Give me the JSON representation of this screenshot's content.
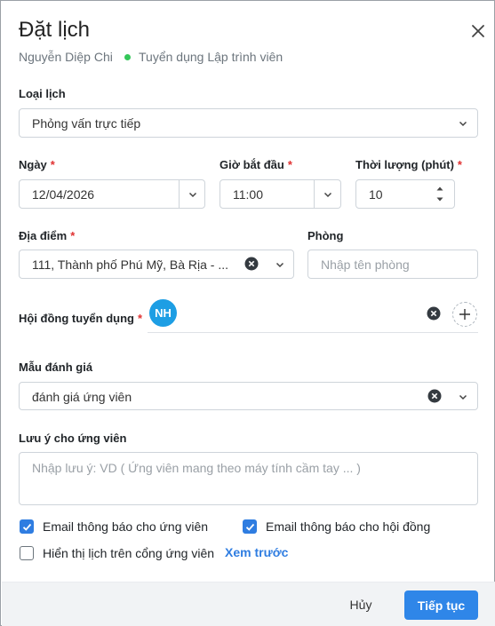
{
  "modal": {
    "title": "Đặt lịch",
    "candidate_name": "Nguyễn Diệp Chi",
    "job_title": "Tuyển dụng Lập trình viên",
    "status_color": "#34c759"
  },
  "schedule_type": {
    "label": "Loại lịch",
    "value": "Phỏng vấn trực tiếp"
  },
  "date": {
    "label": "Ngày",
    "required": "*",
    "value": "12/04/2026"
  },
  "start_time": {
    "label": "Giờ bắt đầu",
    "required": "*",
    "value": "11:00"
  },
  "duration": {
    "label": "Thời lượng (phút)",
    "required": "*",
    "value": "10"
  },
  "location": {
    "label": "Địa điểm",
    "required": "*",
    "value": "111, Thành phố Phú Mỹ, Bà Rịa - ..."
  },
  "room": {
    "label": "Phòng",
    "placeholder": "Nhập tên phòng"
  },
  "council": {
    "label": "Hội đồng tuyển dụng",
    "required": "*",
    "member_initials": "NH",
    "avatar_color": "#1d9ee4"
  },
  "evaluation_template": {
    "label": "Mẫu đánh giá",
    "value": "đánh giá ứng viên"
  },
  "candidate_note": {
    "label": "Lưu ý cho ứng viên",
    "placeholder": "Nhập lưu ý: VD ( Ứng viên mang theo máy tính cầm tay ... )"
  },
  "options": {
    "email_candidate": {
      "label": "Email thông báo cho ứng viên",
      "checked": true
    },
    "email_council": {
      "label": "Email thông báo cho hội đồng",
      "checked": true
    },
    "show_on_portal": {
      "label": "Hiển thị lịch trên cổng ứng viên",
      "checked": false
    },
    "preview_link": "Xem trước"
  },
  "footer": {
    "cancel_label": "Hủy",
    "continue_label": "Tiếp tục",
    "primary_color": "#2f86e8"
  }
}
